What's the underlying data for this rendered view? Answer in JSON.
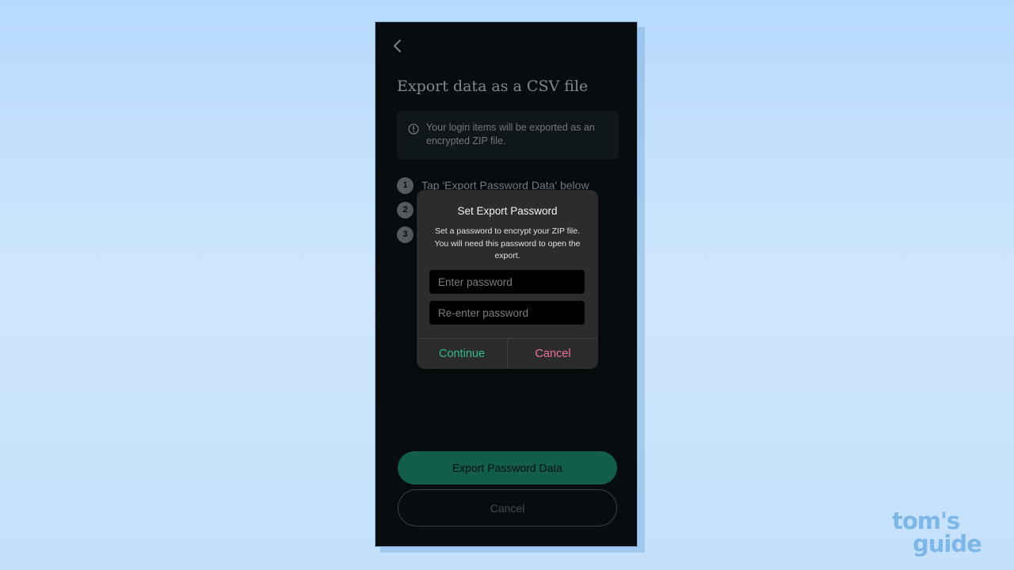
{
  "screen": {
    "title": "Export data as a CSV file",
    "info": "Your login items will be exported as an encrypted ZIP file.",
    "steps": [
      {
        "number": "1",
        "text": "Tap 'Export Password Data' below"
      },
      {
        "number": "2",
        "text": ""
      },
      {
        "number": "3",
        "text": ""
      }
    ],
    "export_button": "Export Password Data",
    "cancel_button": "Cancel"
  },
  "dialog": {
    "title": "Set Export Password",
    "message": "Set a password to encrypt your ZIP file. You will need this password to open the export.",
    "password_placeholder": "Enter password",
    "confirm_placeholder": "Re-enter password",
    "continue_label": "Continue",
    "cancel_label": "Cancel"
  },
  "watermark": {
    "line1": "tom's",
    "line2": "guide"
  },
  "colors": {
    "accent_green": "#1f9878",
    "continue_text": "#2fb88f",
    "cancel_text": "#ee6f9d",
    "phone_background": "#0c1519"
  }
}
